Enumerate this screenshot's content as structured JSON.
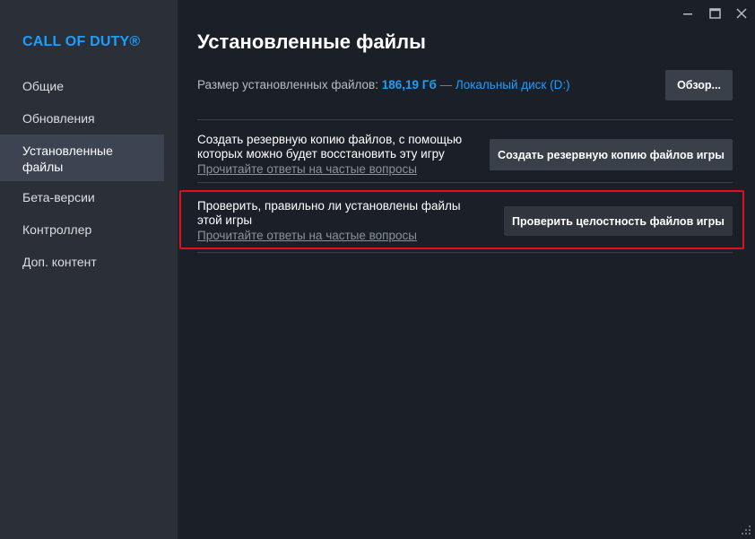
{
  "sidebar": {
    "game_title": "CALL OF DUTY®",
    "items": [
      {
        "label": "Общие"
      },
      {
        "label": "Обновления"
      },
      {
        "label": "Установленные\nфайлы"
      },
      {
        "label": "Бета-версии"
      },
      {
        "label": "Контроллер"
      },
      {
        "label": "Доп. контент"
      }
    ]
  },
  "main": {
    "title": "Установленные файлы",
    "size_label": "Размер установленных файлов:",
    "size_value": "186,19 Гб",
    "size_separator": "—",
    "disk_label": "Локальный диск (D:)",
    "browse_label": "Обзор...",
    "backup": {
      "text": "Создать резервную копию файлов, с помощью которых можно будет восстановить эту игру",
      "link": "Прочитайте ответы на частые вопросы",
      "button": "Создать резервную копию файлов игры"
    },
    "verify": {
      "text": "Проверить, правильно ли установлены файлы этой игры",
      "link": "Прочитайте ответы на частые вопросы",
      "button": "Проверить целостность файлов игры"
    }
  },
  "colors": {
    "accent": "#1a9fff",
    "highlight": "#e0101a",
    "background": "#1b2028",
    "sidebar": "#2a2f38"
  }
}
